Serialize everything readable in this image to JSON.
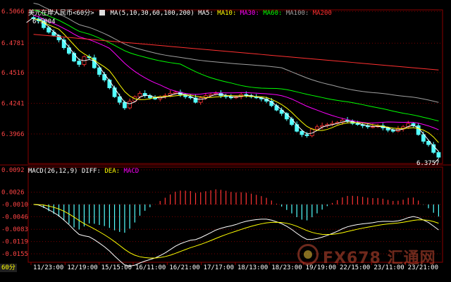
{
  "header": {
    "symbol_title": "美元在岸人民币<60分>",
    "ma_label": "MA(5,10,30,60,100,200)",
    "ma_series": [
      {
        "label": "MA5:",
        "color": "#ffffff"
      },
      {
        "label": "MA10:",
        "color": "#ffff00"
      },
      {
        "label": "MA30:",
        "color": "#ff00ff"
      },
      {
        "label": "MA60:",
        "color": "#00ff00"
      },
      {
        "label": "MA100:",
        "color": "#a0a0a0"
      },
      {
        "label": "MA200",
        "color": "#ff3030"
      }
    ]
  },
  "macd_header": {
    "label": "MACD(26,12,9)",
    "diff": "DIFF:",
    "dea": "DEA:",
    "macd": "MACD",
    "diff_color": "#ffffff",
    "dea_color": "#ffff00",
    "macd_color": "#ff00ff"
  },
  "period_label": "60分",
  "watermark": "FX678 汇通网",
  "price_labels": {
    "high": "6.5004",
    "low": "6.3757"
  },
  "colors": {
    "up": "#ff3333",
    "down": "#54ffff",
    "axis_text": "#ff4444",
    "grid": "#7a0000"
  },
  "chart_data": [
    {
      "type": "candlestick",
      "title": "美元在岸人民币<60分>",
      "y_ticks": [
        "6.5066",
        "6.4781",
        "6.4516",
        "6.4241",
        "6.3966"
      ],
      "ylim": [
        6.37,
        6.508
      ],
      "x_ticks": [
        "11/23:00",
        "12/19:00",
        "15/15:00",
        "16/11:00",
        "16/21:00",
        "17/17:00",
        "18/13:00",
        "18/23:00",
        "19/19:00",
        "22/15:00",
        "23/11:00",
        "23/21:00"
      ],
      "high_marker": 6.5004,
      "low_marker": 6.3757,
      "close": [
        6.5,
        6.498,
        6.492,
        6.488,
        6.485,
        6.481,
        6.474,
        6.469,
        6.462,
        6.459,
        6.466,
        6.465,
        6.456,
        6.45,
        6.445,
        6.438,
        6.43,
        6.425,
        6.42,
        6.426,
        6.43,
        6.433,
        6.431,
        6.429,
        6.428,
        6.43,
        6.431,
        6.433,
        6.434,
        6.432,
        6.43,
        6.429,
        6.425,
        6.429,
        6.431,
        6.432,
        6.433,
        6.431,
        6.43,
        6.429,
        6.43,
        6.432,
        6.431,
        6.43,
        6.429,
        6.428,
        6.426,
        6.422,
        6.418,
        6.415,
        6.41,
        6.405,
        6.399,
        6.396,
        6.395,
        6.401,
        6.403,
        6.404,
        6.405,
        6.406,
        6.407,
        6.409,
        6.408,
        6.406,
        6.405,
        6.404,
        6.403,
        6.403,
        6.404,
        6.402,
        6.4,
        6.399,
        6.401,
        6.403,
        6.406,
        6.404,
        6.396,
        6.39,
        6.387,
        6.38,
        6.3757
      ]
    },
    {
      "type": "bar",
      "title": "MACD(26,12,9)",
      "y_ticks": [
        "0.0092",
        "0.0026",
        "-0.0010",
        "-0.0046",
        "-0.0083",
        "-0.0119",
        "-0.0155"
      ],
      "ylim": [
        -0.018,
        0.01
      ],
      "series_names": [
        "DIFF",
        "DEA",
        "MACD"
      ]
    }
  ]
}
